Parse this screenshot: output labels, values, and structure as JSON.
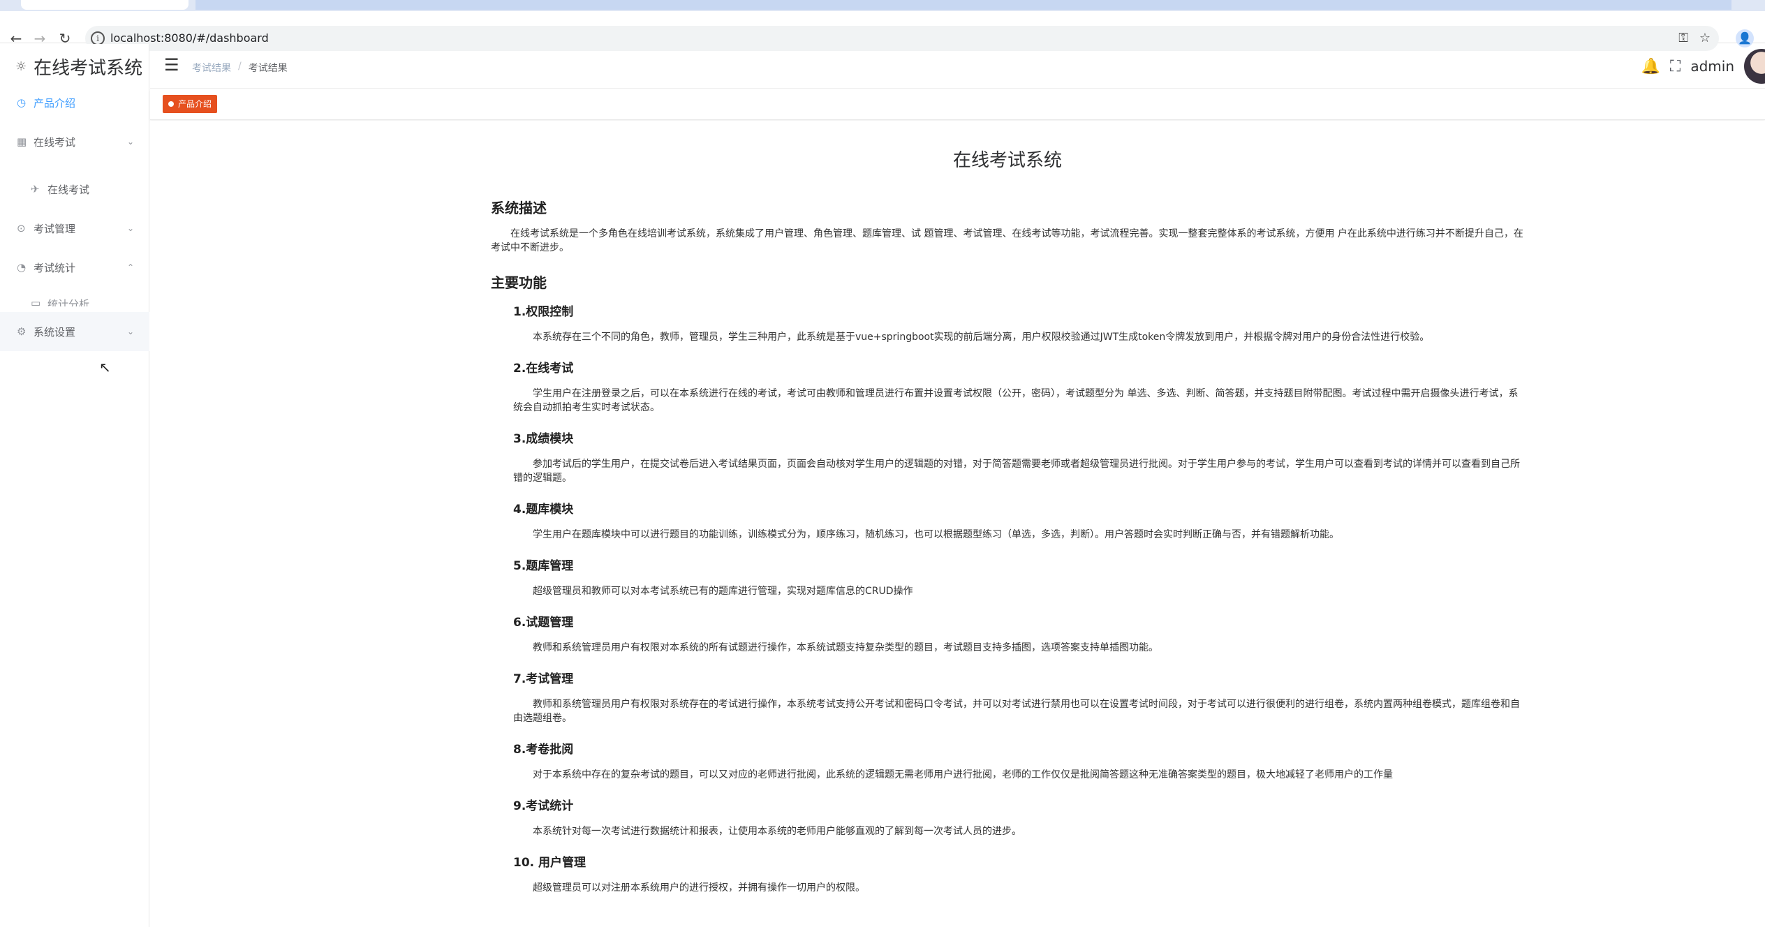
{
  "browser": {
    "url": "localhost:8080/#/dashboard",
    "back_icon": "←",
    "forward_icon": "→",
    "reload_icon": "↻",
    "info_icon": "i",
    "key_icon": "⚿",
    "star_icon": "☆",
    "profile_icon": "👤"
  },
  "sidebar": {
    "logo_icon": "☼",
    "logo_text": "在线考试系统",
    "items": [
      {
        "label": "产品介绍",
        "icon": "◷",
        "arrow": ""
      },
      {
        "label": "在线考试",
        "icon": "▦",
        "arrow": "⌄"
      },
      {
        "label": "在线考试",
        "icon": "✈",
        "arrow": ""
      },
      {
        "label": "考试管理",
        "icon": "⊙",
        "arrow": "⌄"
      },
      {
        "label": "考试统计",
        "icon": "◔",
        "arrow": "⌃"
      },
      {
        "label": "统计分析",
        "icon": "▭",
        "arrow": ""
      },
      {
        "label": "系统设置",
        "icon": "⚙",
        "arrow": "⌄"
      }
    ],
    "cursor": "↖"
  },
  "navbar": {
    "hamburger": "☰",
    "breadcrumb": [
      "考试结果",
      "/",
      "考试结果"
    ],
    "bell_icon": "🔔",
    "fullscreen_icon": "⛶",
    "username": "admin"
  },
  "tags": {
    "active": "产品介绍"
  },
  "doc": {
    "title": "在线考试系统",
    "desc_heading": "系统描述",
    "desc": "在线考试系统是一个多角色在线培训考试系统，系统集成了用户管理、角色管理、题库管理、试 题管理、考试管理、在线考试等功能，考试流程完善。实现一整套完整体系的考试系统，方便用 户在此系统中进行练习并不断提升自己，在考试中不断进步。",
    "features_heading": "主要功能",
    "features": [
      {
        "title": "1.权限控制",
        "desc": "本系统存在三个不同的角色，教师，管理员，学生三种用户，此系统是基于vue+springboot实现的前后端分离，用户权限校验通过JWT生成token令牌发放到用户，并根据令牌对用户的身份合法性进行校验。"
      },
      {
        "title": "2.在线考试",
        "desc": "学生用户在注册登录之后，可以在本系统进行在线的考试，考试可由教师和管理员进行布置并设置考试权限（公开，密码），考试题型分为 单选、多选、判断、简答题，并支持题目附带配图。考试过程中需开启摄像头进行考试，系统会自动抓拍考生实时考试状态。"
      },
      {
        "title": "3.成绩模块",
        "desc": "参加考试后的学生用户，在提交试卷后进入考试结果页面，页面会自动核对学生用户的逻辑题的对错，对于简答题需要老师或者超级管理员进行批阅。对于学生用户参与的考试，学生用户可以查看到考试的详情并可以查看到自己所错的逻辑题。"
      },
      {
        "title": "4.题库模块",
        "desc": "学生用户在题库模块中可以进行题目的功能训练，训练模式分为，顺序练习，随机练习，也可以根据题型练习（单选，多选，判断）。用户答题时会实时判断正确与否，并有错题解析功能。"
      },
      {
        "title": "5.题库管理",
        "desc": "超级管理员和教师可以对本考试系统已有的题库进行管理，实现对题库信息的CRUD操作"
      },
      {
        "title": "6.试题管理",
        "desc": "教师和系统管理员用户有权限对本系统的所有试题进行操作，本系统试题支持复杂类型的题目，考试题目支持多插图，选项答案支持单插图功能。"
      },
      {
        "title": "7.考试管理",
        "desc": "教师和系统管理员用户有权限对系统存在的考试进行操作，本系统考试支持公开考试和密码口令考试，并可以对考试进行禁用也可以在设置考试时间段，对于考试可以进行很便利的进行组卷，系统内置两种组卷模式，题库组卷和自由选题组卷。"
      },
      {
        "title": "8.考卷批阅",
        "desc": "对于本系统中存在的复杂考试的题目，可以又对应的老师进行批阅，此系统的逻辑题无需老师用户进行批阅，老师的工作仅仅是批阅简答题这种无准确答案类型的题目，极大地减轻了老师用户的工作量"
      },
      {
        "title": "9.考试统计",
        "desc": "本系统针对每一次考试进行数据统计和报表，让使用本系统的老师用户能够直观的了解到每一次考试人员的进步。"
      },
      {
        "title": "10. 用户管理",
        "desc": "超级管理员可以对注册本系统用户的进行授权，并拥有操作一切用户的权限。"
      }
    ]
  },
  "colors": {
    "accent": "#409eff",
    "tag_bg": "#e6501f"
  }
}
